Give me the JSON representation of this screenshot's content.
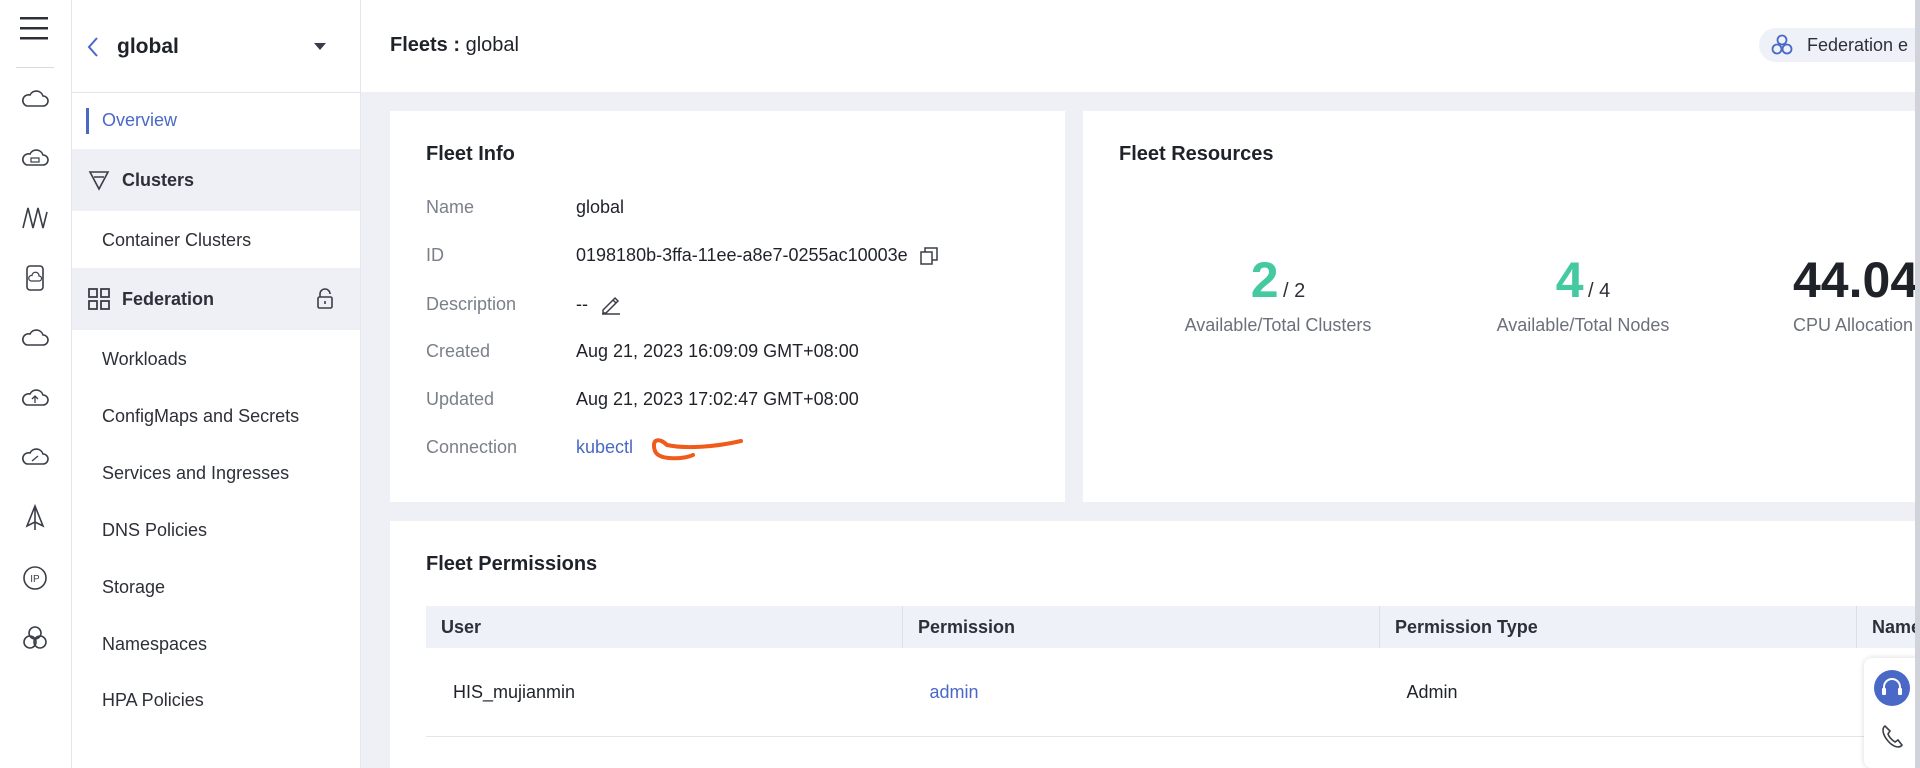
{
  "nav": {
    "title": "global",
    "overview": "Overview",
    "clusters_group": "Clusters",
    "container_clusters": "Container Clusters",
    "federation_group": "Federation",
    "items": [
      "Workloads",
      "ConfigMaps and Secrets",
      "Services and Ingresses",
      "DNS Policies",
      "Storage",
      "Namespaces",
      "HPA Policies"
    ]
  },
  "topbar": {
    "crumb_prefix": "Fleets :",
    "crumb_value": "global",
    "federation_pill": "Federation e"
  },
  "fleet_info": {
    "title": "Fleet Info",
    "rows": [
      {
        "key": "Name",
        "value": "global"
      },
      {
        "key": "ID",
        "value": "0198180b-3ffa-11ee-a8e7-0255ac10003e"
      },
      {
        "key": "Description",
        "value": "--"
      },
      {
        "key": "Created",
        "value": "Aug 21, 2023 16:09:09 GMT+08:00"
      },
      {
        "key": "Updated",
        "value": "Aug 21, 2023 17:02:47 GMT+08:00"
      },
      {
        "key": "Connection",
        "value": "kubectl"
      }
    ]
  },
  "fleet_resources": {
    "title": "Fleet Resources",
    "stats": [
      {
        "value": "2",
        "total": "/ 2",
        "caption": "Available/Total Clusters"
      },
      {
        "value": "4",
        "total": "/ 4",
        "caption": "Available/Total Nodes"
      },
      {
        "value": "44.04",
        "total": "",
        "caption": "CPU Allocation"
      }
    ]
  },
  "fleet_permissions": {
    "title": "Fleet Permissions",
    "columns": [
      "User",
      "Permission",
      "Permission Type",
      "Name"
    ],
    "rows": [
      {
        "user": "HIS_mujianmin",
        "permission": "admin",
        "type": "Admin",
        "name": ""
      }
    ]
  },
  "colors": {
    "accent": "#4a68c6",
    "success": "#44c9a0",
    "annotation": "#f05a1a"
  }
}
